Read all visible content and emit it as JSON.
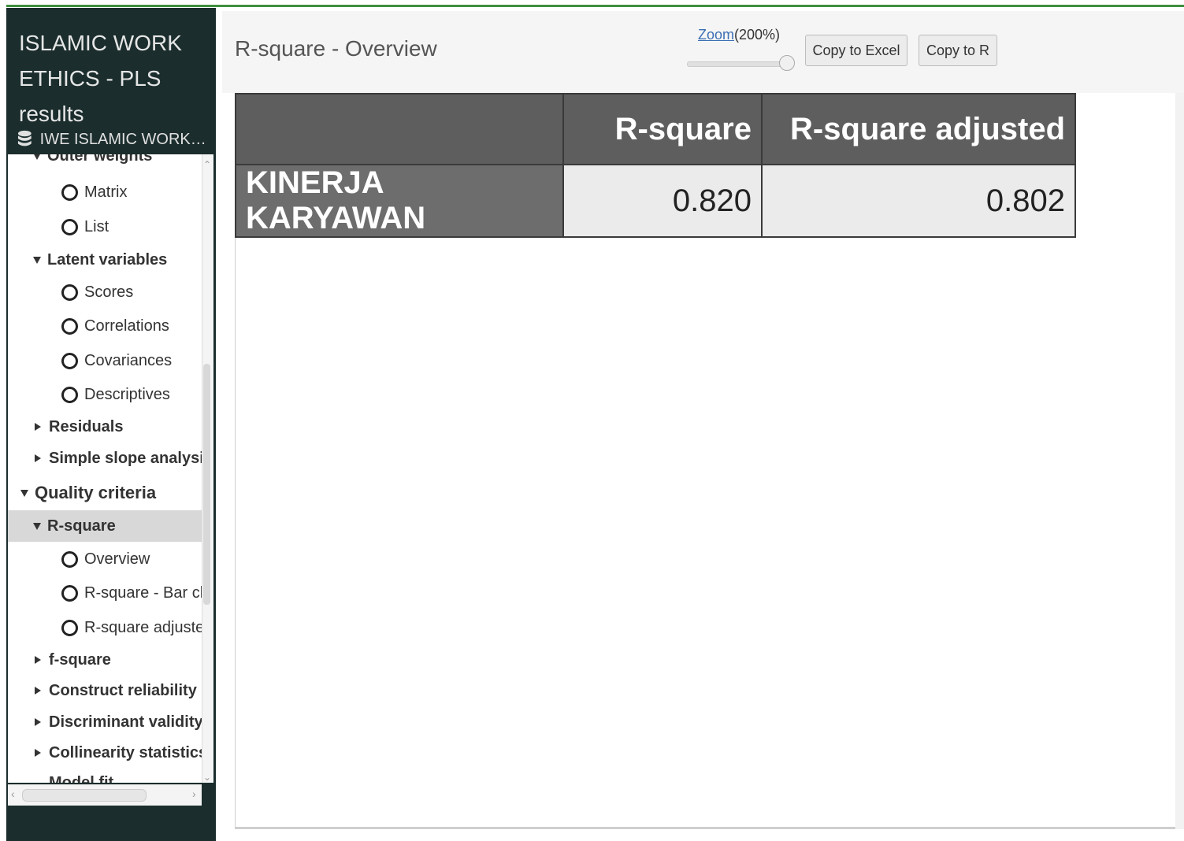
{
  "sidebar": {
    "title": "ISLAMIC WORK ETHICS - PLS results",
    "dataset_label": "IWE ISLAMIC WORK E...",
    "tree": {
      "outer_weights": "Outer weights",
      "matrix": "Matrix",
      "list": "List",
      "latent_variables": "Latent variables",
      "scores": "Scores",
      "correlations": "Correlations",
      "covariances": "Covariances",
      "descriptives": "Descriptives",
      "residuals": "Residuals",
      "simple_slope": "Simple slope analysis",
      "quality_criteria": "Quality criteria",
      "r_square": "R-square",
      "overview": "Overview",
      "r_square_bar": "R-square - Bar char",
      "r_square_adjusted": "R-square adjusted -",
      "f_square": "f-square",
      "construct_reliability": "Construct reliability and",
      "discriminant_validity": "Discriminant validity",
      "collinearity": "Collinearity statistics (V",
      "model_fit": "Model fit"
    }
  },
  "header": {
    "title": "R-square - Overview",
    "zoom_link": "Zoom",
    "zoom_value": "(200%)",
    "zoom_level_percent": 200,
    "copy_excel": "Copy to Excel",
    "copy_r": "Copy to R"
  },
  "table": {
    "columns": [
      "",
      "R-square",
      "R-square adjusted"
    ],
    "rows": [
      {
        "label": "KINERJA KARYAWAN",
        "r_square": "0.820",
        "r_square_adjusted": "0.802"
      }
    ]
  },
  "colors": {
    "sidebar_bg": "#1b2d2d",
    "accent_top": "#3f8f3f",
    "table_header_bg": "#5e5e5e",
    "table_value_bg": "#ebebeb",
    "selected_bg": "#d8d8d8"
  }
}
